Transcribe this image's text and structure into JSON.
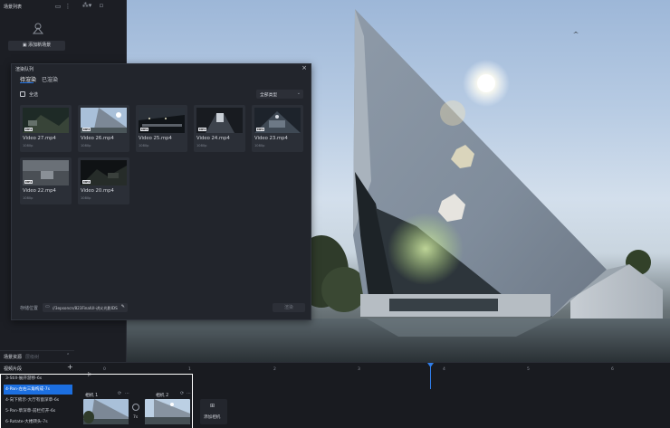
{
  "scene_panel": {
    "title": "场景列表",
    "add_scene_label": "添加新场景",
    "footer_tab_active": "场景资源",
    "footer_tab_inactive": "层级树"
  },
  "render_dialog": {
    "title": "渲染队列",
    "tabs": [
      "待渲染",
      "已渲染"
    ],
    "select_all_label": "全选",
    "filter_value": "全部类型",
    "videos": [
      {
        "name": "Video 27.mp4",
        "meta": "1080p",
        "tag": "MP4"
      },
      {
        "name": "Video 26.mp4",
        "meta": "1080p",
        "tag": "MP4"
      },
      {
        "name": "Video 25.mp4",
        "meta": "1080p",
        "tag": "MP4"
      },
      {
        "name": "Video 24.mp4",
        "meta": "1080p",
        "tag": "MP4"
      },
      {
        "name": "Video 23.mp4",
        "meta": "1080p",
        "tag": "MP4"
      },
      {
        "name": "Video 22.mp4",
        "meta": "1080p",
        "tag": "MP4"
      },
      {
        "name": "Video 20.mp4",
        "meta": "1080p",
        "tag": "MP4"
      }
    ],
    "save_path_label": "存储位置",
    "save_path_value": "//3epsoncn/823FinalUI-讲义光影IDS",
    "confirm_label": "渲染"
  },
  "timeline": {
    "title": "视频片段",
    "ruler": [
      "0",
      "1",
      "2",
      "3",
      "4",
      "5",
      "6"
    ],
    "shots": [
      "3-Still-展开游移-6s",
      "4-Pan-左右三角构成-7s",
      "4-向下俯示-大厅有窗深草-6s",
      "5-Pan-草深草-前栏打开-6s",
      "6-Rotate-大楼转头-7s"
    ],
    "active_shot_index": 1,
    "cameras": [
      {
        "label": "相机 1"
      },
      {
        "label": "相机 2"
      }
    ],
    "transition_label": "7s",
    "add_camera_label": "添加相机"
  },
  "colors": {
    "accent": "#1c6fe0",
    "panel": "#22252c",
    "highlight_border": "#ffffff"
  }
}
